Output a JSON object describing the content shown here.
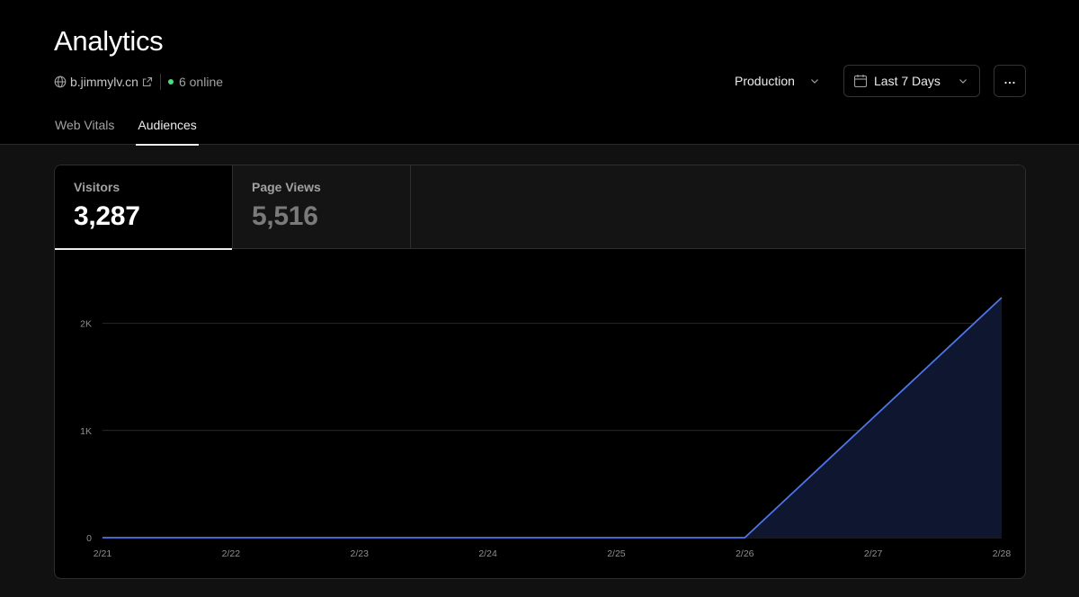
{
  "header": {
    "title": "Analytics",
    "domain": "b.jimmylv.cn",
    "online": "6 online"
  },
  "controls": {
    "environment": "Production",
    "date_range": "Last 7 Days"
  },
  "tabs": [
    {
      "label": "Web Vitals",
      "active": false
    },
    {
      "label": "Audiences",
      "active": true
    }
  ],
  "metrics": [
    {
      "label": "Visitors",
      "value": "3,287",
      "active": true
    },
    {
      "label": "Page Views",
      "value": "5,516",
      "active": false
    }
  ],
  "colors": {
    "accent_line": "#4f75e8",
    "area_fill": "#0e1630",
    "online_dot": "#4ade80"
  },
  "chart_data": {
    "type": "area",
    "x": [
      "2/21",
      "2/22",
      "2/23",
      "2/24",
      "2/25",
      "2/26",
      "2/27",
      "2/28"
    ],
    "series": [
      {
        "values": [
          0,
          0,
          0,
          0,
          0,
          0,
          1120,
          2240
        ]
      }
    ],
    "ylim": [
      0,
      2500
    ],
    "yticks": [
      0,
      1000,
      2000
    ],
    "ytick_labels": [
      "0",
      "1K",
      "2K"
    ],
    "grid": true
  }
}
